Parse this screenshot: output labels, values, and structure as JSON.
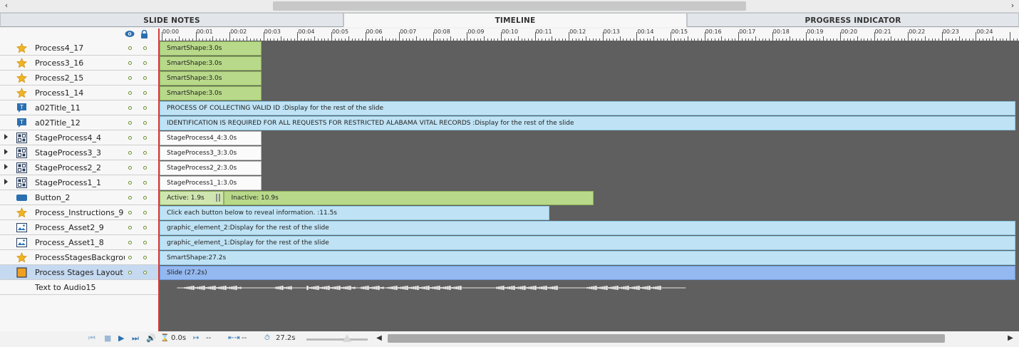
{
  "tabs": [
    {
      "label": "SLIDE NOTES",
      "active": false
    },
    {
      "label": "TIMELINE",
      "active": true
    },
    {
      "label": "PROGRESS INDICATOR",
      "active": false
    }
  ],
  "ruler": {
    "labels": [
      "00:00",
      "00:01",
      "00:02",
      "00:03",
      "00:04",
      "00:05",
      "00:06",
      "00:07",
      "00:08",
      "00:09",
      "00:10",
      "00:11",
      "00:12",
      "00:13",
      "00:14",
      "00:15",
      "00:16",
      "00:17",
      "00:18",
      "00:19",
      "00:20",
      "00:21",
      "00:22",
      "00:23",
      "00:24"
    ]
  },
  "layers": [
    {
      "name": "Process4_17",
      "icon": "star-icon",
      "expandable": false,
      "bar": {
        "style": "green",
        "label": "SmartShape:3.0s",
        "start": 0,
        "duration": 3.0
      }
    },
    {
      "name": "Process3_16",
      "icon": "star-icon",
      "expandable": false,
      "bar": {
        "style": "green",
        "label": "SmartShape:3.0s",
        "start": 0,
        "duration": 3.0
      }
    },
    {
      "name": "Process2_15",
      "icon": "star-icon",
      "expandable": false,
      "bar": {
        "style": "green",
        "label": "SmartShape:3.0s",
        "start": 0,
        "duration": 3.0
      }
    },
    {
      "name": "Process1_14",
      "icon": "star-icon",
      "expandable": false,
      "bar": {
        "style": "green",
        "label": "SmartShape:3.0s",
        "start": 0,
        "duration": 3.0
      }
    },
    {
      "name": "a02Title_11",
      "icon": "text-caption-icon",
      "expandable": false,
      "bar": {
        "style": "blue",
        "label": "PROCESS OF COLLECTING VALID ID :Display for the rest of the slide",
        "start": 0,
        "duration": 27.2
      }
    },
    {
      "name": "a02Title_12",
      "icon": "text-caption-icon",
      "expandable": false,
      "bar": {
        "style": "blue",
        "label": "IDENTIFICATION IS REQUIRED FOR ALL REQUESTS  FOR RESTRICTED ALABAMA VITAL RECORDS :Display for the rest of the slide",
        "start": 0,
        "duration": 27.2
      }
    },
    {
      "name": "StageProcess4_4",
      "icon": "group-icon",
      "expandable": true,
      "bar": {
        "style": "white",
        "label": "StageProcess4_4:3.0s",
        "start": 0,
        "duration": 3.0
      }
    },
    {
      "name": "StageProcess3_3",
      "icon": "group-icon",
      "expandable": true,
      "bar": {
        "style": "white",
        "label": "StageProcess3_3:3.0s",
        "start": 0,
        "duration": 3.0
      }
    },
    {
      "name": "StageProcess2_2",
      "icon": "group-icon",
      "expandable": true,
      "bar": {
        "style": "white",
        "label": "StageProcess2_2:3.0s",
        "start": 0,
        "duration": 3.0
      }
    },
    {
      "name": "StageProcess1_1",
      "icon": "group-icon",
      "expandable": true,
      "bar": {
        "style": "white",
        "label": "StageProcess1_1:3.0s",
        "start": 0,
        "duration": 3.0
      }
    },
    {
      "name": "Button_2",
      "icon": "button-icon",
      "expandable": false,
      "bar": {
        "style": "button",
        "active_label": "Active: 1.9s",
        "inactive_label": "Inactive: 10.9s",
        "start": 0,
        "active": 1.9,
        "inactive": 10.9
      }
    },
    {
      "name": "Process_Instructions_9",
      "icon": "star-icon",
      "expandable": false,
      "bar": {
        "style": "blue",
        "label": "Click each button below to reveal information. :11.5s",
        "start": 0,
        "duration": 11.5
      }
    },
    {
      "name": "Process_Asset2_9",
      "icon": "image-icon",
      "expandable": false,
      "bar": {
        "style": "blue",
        "label": "graphic_element_2:Display for the rest of the slide",
        "start": 0,
        "duration": 27.2
      }
    },
    {
      "name": "Process_Asset1_8",
      "icon": "image-icon",
      "expandable": false,
      "bar": {
        "style": "blue",
        "label": "graphic_element_1:Display for the rest of the slide",
        "start": 0,
        "duration": 27.2
      }
    },
    {
      "name": "ProcessStagesBackgroun",
      "icon": "star-icon",
      "expandable": false,
      "bar": {
        "style": "blue",
        "label": "SmartShape:27.2s",
        "start": 0,
        "duration": 27.2
      }
    },
    {
      "name": "Process Stages Layout",
      "icon": "slide-icon",
      "expandable": false,
      "selected": true,
      "bar": {
        "style": "slide",
        "label": "Slide (27.2s)",
        "start": 0,
        "duration": 27.2
      }
    },
    {
      "name": "Text to Audio15",
      "icon": "",
      "expandable": false,
      "bar": {
        "style": "audio",
        "start": 0.3,
        "duration": 15.0
      }
    }
  ],
  "bottom": {
    "current_time": "0.0s",
    "start_time": "--",
    "duration_time": "--",
    "total_time": "27.2s"
  },
  "colors": {
    "green": "#b8d98a",
    "blue": "#bfe3f5",
    "slide": "#94b8f0",
    "track": "#5f5f5f",
    "playhead": "#d23c3c",
    "accent": "#2a6fb0"
  }
}
